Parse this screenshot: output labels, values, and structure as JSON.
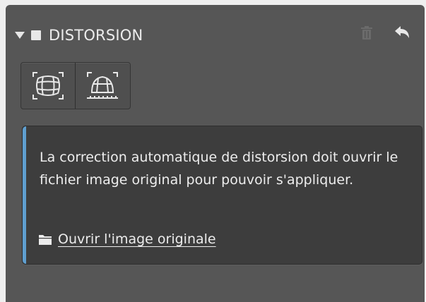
{
  "section": {
    "title": "DISTORSION",
    "checkbox_checked": true,
    "expanded": true,
    "icons": [
      "disclosure-triangle-icon",
      "trash-icon",
      "reset-arrow-icon"
    ]
  },
  "tools": [
    {
      "name": "auto-distortion-icon"
    },
    {
      "name": "perspective-grid-icon"
    }
  ],
  "info": {
    "message": "La correction automatique de distorsion doit ouvrir le fichier image original pour pouvoir s'appliquer.",
    "link_label": "Ouvrir l'image originale",
    "link_icon": "folder-icon"
  },
  "colors": {
    "panel_bg": "#565656",
    "info_bg": "#3d3d3d",
    "accent": "#5f9fd0",
    "text": "#ececec"
  }
}
